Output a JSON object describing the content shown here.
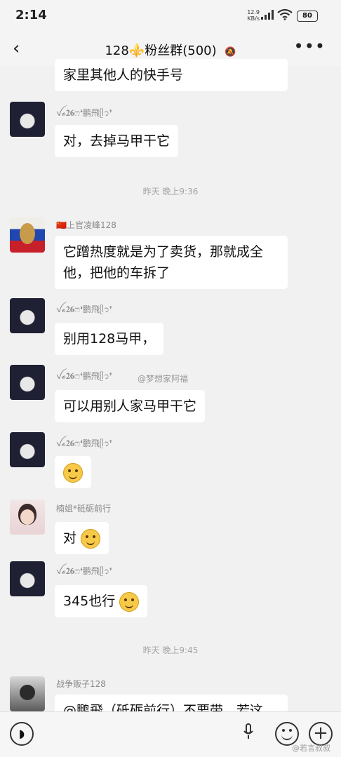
{
  "status": {
    "time": "2:14",
    "speed_top": "12.9",
    "speed_bottom": "KB/s",
    "battery": "80"
  },
  "header": {
    "back": "‹",
    "title": "128⚜️粉丝群(500)",
    "more": "•••"
  },
  "messages": [
    {
      "nick": "",
      "text": "家里其他人的快手号"
    },
    {
      "nick": "ꪜ𝓸𝟐𝟔ෆ❛鹏飛ᥫ᭡❜",
      "text": "对，去掉马甲干它"
    },
    {
      "nick": "🇨🇳上官凌峰128",
      "text": "它蹭热度就是为了卖货，那就成全他，把他的车拆了"
    },
    {
      "nick": "ꪜ𝓸𝟐𝟔ෆ❛鹏飛ᥫ᭡❜",
      "text": "别用128马甲，"
    },
    {
      "nick": "ꪜ𝓸𝟐𝟔ෆ❛鹏飛ᥫ᭡❜",
      "text": "可以用别人家马甲干它"
    },
    {
      "nick": "ꪜ𝓸𝟐𝟔ෆ❛鹏飛ᥫ᭡❜",
      "text": ""
    },
    {
      "nick": "楠姐*砥砺前行",
      "text": "对"
    },
    {
      "nick": "ꪜ𝓸𝟐𝟔ෆ❛鹏飛ᥫ᭡❜",
      "text": "345也行"
    },
    {
      "nick": "战争贩子128",
      "text": "@鹏飛（砥砺前行）不要带，若这"
    }
  ],
  "timestamps": [
    "昨天 晚上9:36",
    "昨天 晚上9:45"
  ],
  "watermarks": [
    "@梦想家阿福",
    "@若言叔叔"
  ],
  "icons": {
    "signal": "signal-icon",
    "wifi": "wifi-icon",
    "voice": "voice-icon",
    "mic": "mic-icon",
    "emoji": "emoji-icon",
    "plus": "plus-icon"
  }
}
